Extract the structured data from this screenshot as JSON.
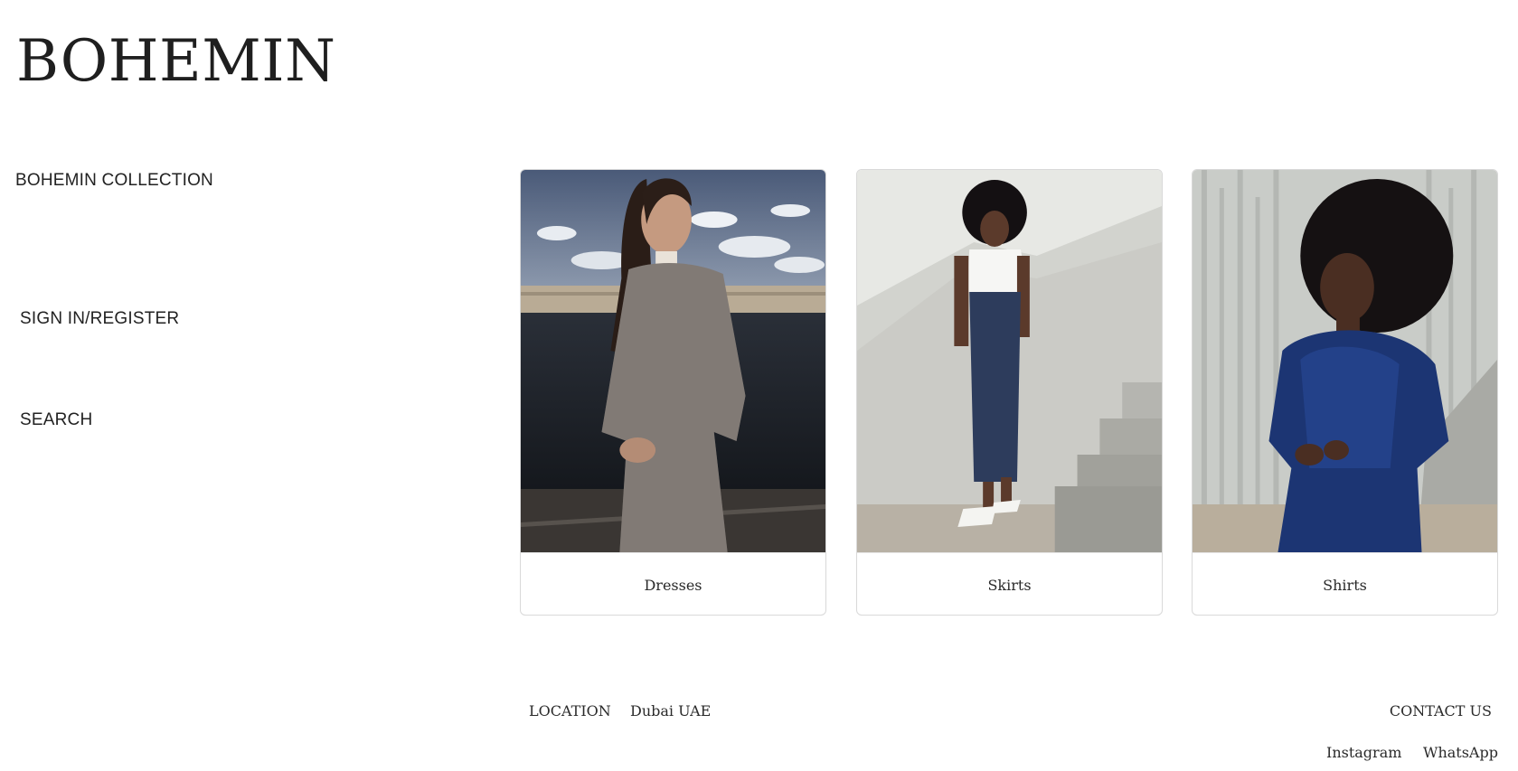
{
  "brand": {
    "name": "BOHEMIN"
  },
  "sidebar": {
    "collection": "BOHEMIN COLLECTION",
    "signin": "SIGN IN/REGISTER",
    "search": "SEARCH"
  },
  "categories": [
    {
      "label": "Dresses",
      "image": "woman-in-leopard-print-dress-by-river"
    },
    {
      "label": "Skirts",
      "image": "woman-in-white-tee-and-navy-skirt-by-stairs"
    },
    {
      "label": "Shirts",
      "image": "woman-in-navy-satin-shirt-by-concrete-wall"
    }
  ],
  "footer": {
    "location_label": "LOCATION",
    "location_value": "Dubai UAE",
    "contact_label": "CONTACT US",
    "instagram": "Instagram",
    "whatsapp": "WhatsApp"
  },
  "colors": {
    "text": "#222222",
    "background": "#ffffff",
    "card_border": "#d9d9d9"
  }
}
